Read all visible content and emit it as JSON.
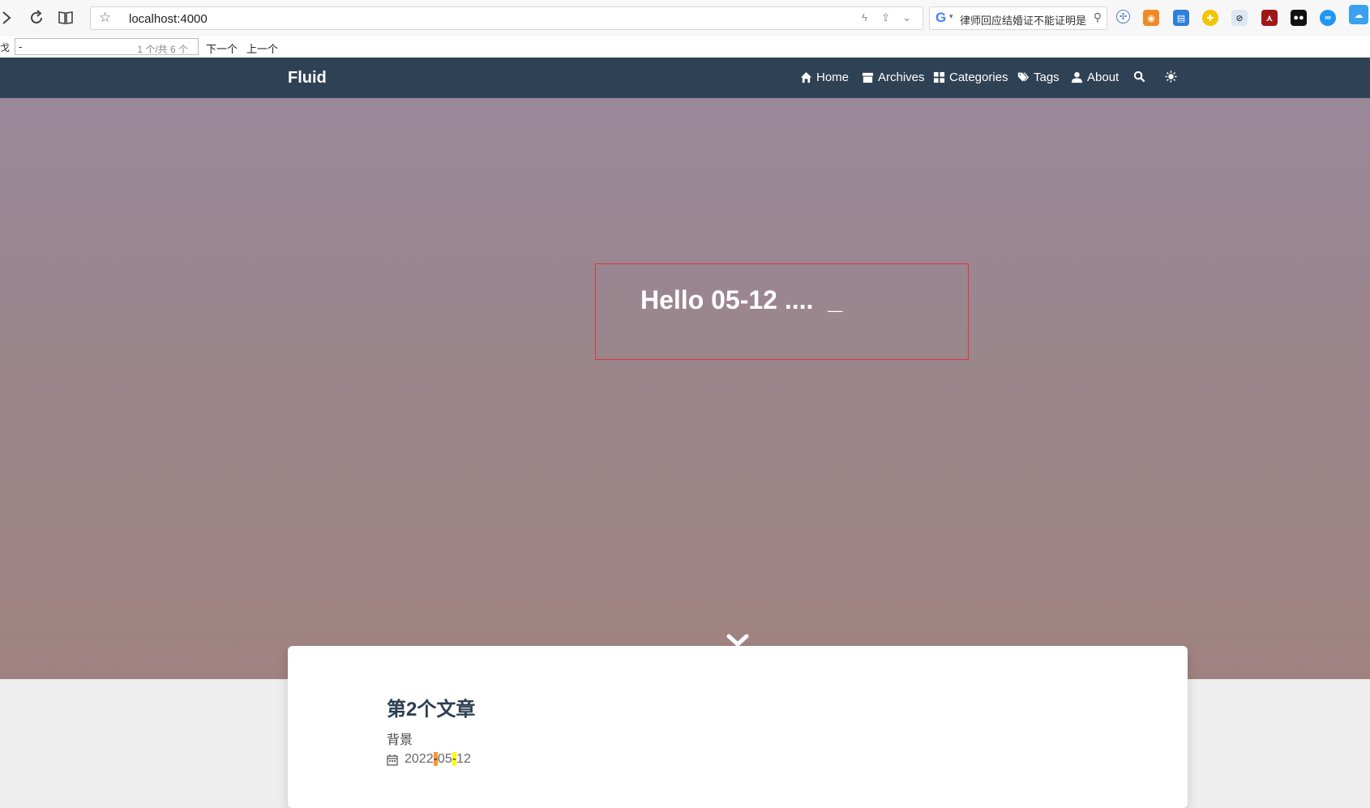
{
  "browser": {
    "url": "localhost:4000",
    "search_text": "律师回应结婚证不能证明是"
  },
  "find_bar": {
    "prefix": "戈",
    "query": "-",
    "count": "1 个/共 6 个",
    "next_label": "下一个",
    "prev_label": "上一个"
  },
  "navbar": {
    "brand": "Fluid",
    "items": [
      {
        "label": "Home",
        "icon": "home-icon"
      },
      {
        "label": "Archives",
        "icon": "archive-icon"
      },
      {
        "label": "Categories",
        "icon": "categories-icon"
      },
      {
        "label": "Tags",
        "icon": "tags-icon"
      },
      {
        "label": "About",
        "icon": "user-icon"
      }
    ]
  },
  "banner": {
    "headline": "Hello 05-12 ....",
    "cursor": "_"
  },
  "post": {
    "title": "第2个文章",
    "excerpt": "背景",
    "date_parts": [
      "2022",
      "-",
      "05",
      "-",
      "12"
    ]
  },
  "colors": {
    "navbar_bg": "#2f4154",
    "find_highlight_current": "#ff9632",
    "find_highlight_other": "#ffff00"
  }
}
